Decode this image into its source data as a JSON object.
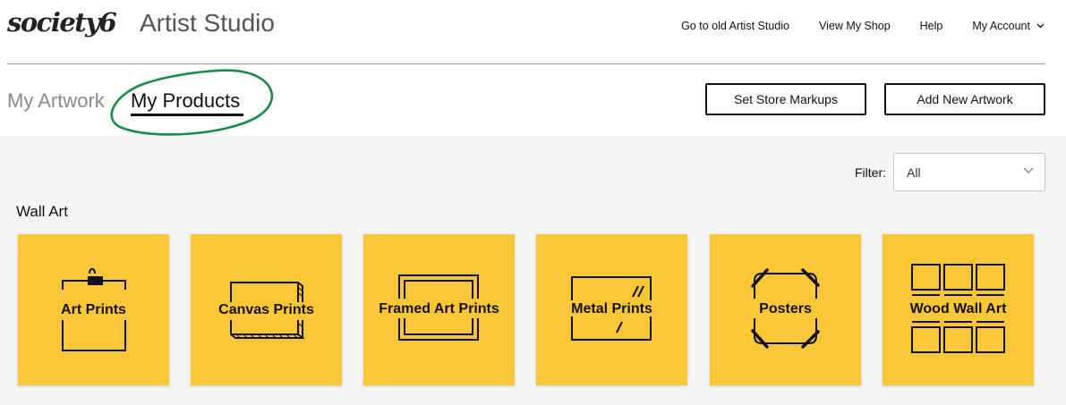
{
  "header": {
    "logo": "society6",
    "app_title": "Artist Studio",
    "nav": {
      "old_studio": "Go to old Artist Studio",
      "view_shop": "View My Shop",
      "help": "Help",
      "account": "My Account"
    }
  },
  "tabs": {
    "artwork": "My Artwork",
    "products": "My Products",
    "active": "My Products"
  },
  "actions": {
    "markups": "Set Store Markups",
    "add_artwork": "Add New Artwork"
  },
  "filter": {
    "label": "Filter:",
    "value": "All"
  },
  "section": {
    "title": "Wall Art"
  },
  "products": [
    {
      "label": "Art Prints",
      "icon": "art-print-icon"
    },
    {
      "label": "Canvas Prints",
      "icon": "canvas-print-icon"
    },
    {
      "label": "Framed Art Prints",
      "icon": "framed-print-icon"
    },
    {
      "label": "Metal Prints",
      "icon": "metal-print-icon"
    },
    {
      "label": "Posters",
      "icon": "poster-icon"
    },
    {
      "label": "Wood Wall Art",
      "icon": "wood-wall-art-icon"
    }
  ],
  "colors": {
    "card_bg": "#fbc737",
    "highlight_circle": "#1a8a4a",
    "panel_bg": "#f5f5f5"
  }
}
